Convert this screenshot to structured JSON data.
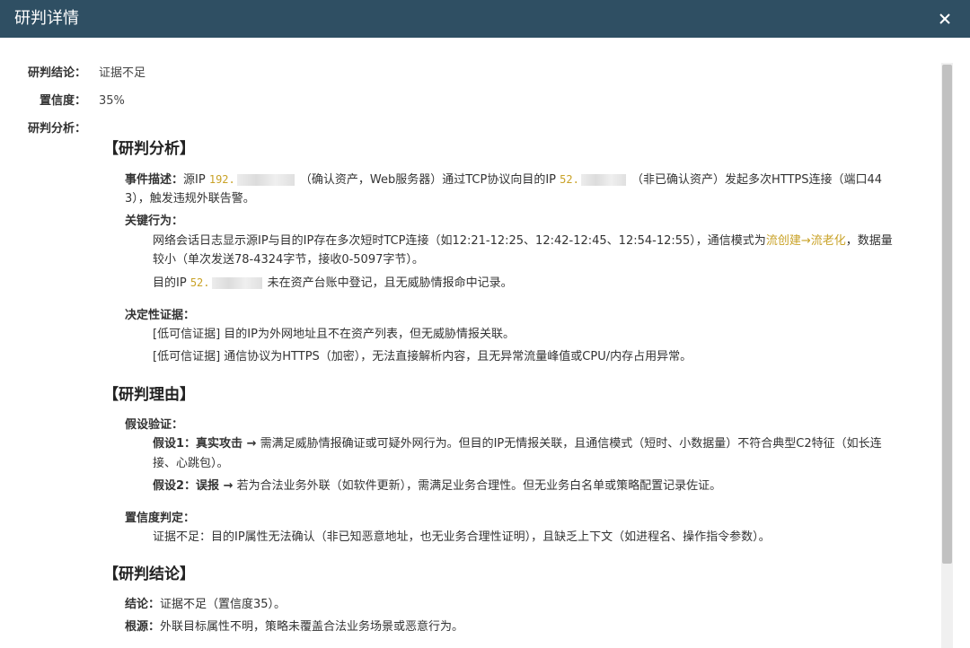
{
  "window": {
    "title": "研判详情"
  },
  "summary": {
    "conclusion_label": "研判结论：",
    "conclusion_value": "证据不足",
    "confidence_label": "置信度：",
    "confidence_value": "35%",
    "analysis_label": "研判分析："
  },
  "analysis": {
    "title": "【研判分析】",
    "event_label": "事件描述：",
    "event_text_1": "源IP",
    "src_ip": "192.",
    "event_text_2": "（确认资产，Web服务器）通过TCP协议向目的IP",
    "dst_ip": "52.",
    "event_text_3": "（非已确认资产）发起多次HTTPS连接（端口44",
    "event_text_4": "3），触发违规外联告警。",
    "behavior_label": "关键行为：",
    "behavior_1a": "网络会话日志显示源IP与目的IP存在多次短时TCP连接（如12:21-12:25、12:42-12:45、12:54-12:55），通信模式为",
    "behavior_1_hl": "流创建→流老化",
    "behavior_1b": "，数据量",
    "behavior_1c": "较小（单次发送78-4324字节，接收0-5097字节）。",
    "behavior_2a": "目的IP",
    "behavior_2_ip": "52.",
    "behavior_2b": "未在资产台账中登记，且无威胁情报命中记录。",
    "evidence_label": "决定性证据：",
    "evidence_1": "[低可信证据] 目的IP为外网地址且不在资产列表，但无威胁情报关联。",
    "evidence_2": "[低可信证据] 通信协议为HTTPS（加密），无法直接解析内容，且无异常流量峰值或CPU/内存占用异常。"
  },
  "reasoning": {
    "title": "【研判理由】",
    "hypothesis_label": "假设验证：",
    "h1_label": "假设1：真实攻击 →",
    "h1_text": " 需满足威胁情报确证或可疑外网行为。但目的IP无情报关联，且通信模式（短时、小数据量）不符合典型C2特征（如长连",
    "h1_text_2": "接、心跳包）。",
    "h2_label": "假设2：误报 →",
    "h2_text": " 若为合法业务外联（如软件更新），需满足业务合理性。但无业务白名单或策略配置记录佐证。",
    "confidence_label": "置信度判定：",
    "confidence_text": "证据不足：目的IP属性无法确认（非已知恶意地址，也无业务合理性证明），且缺乏上下文（如进程名、操作指令参数）。"
  },
  "conclusion": {
    "title": "【研判结论】",
    "c1_label": "结论：",
    "c1_text": "证据不足（置信度35）。",
    "c2_label": "根源：",
    "c2_text": "外联目标属性不明，策略未覆盖合法业务场景或恶意行为。"
  },
  "colors": {
    "titlebar": "#2f4f63",
    "ip_highlight": "#c9a227"
  },
  "icons": {
    "close": "close-icon"
  }
}
